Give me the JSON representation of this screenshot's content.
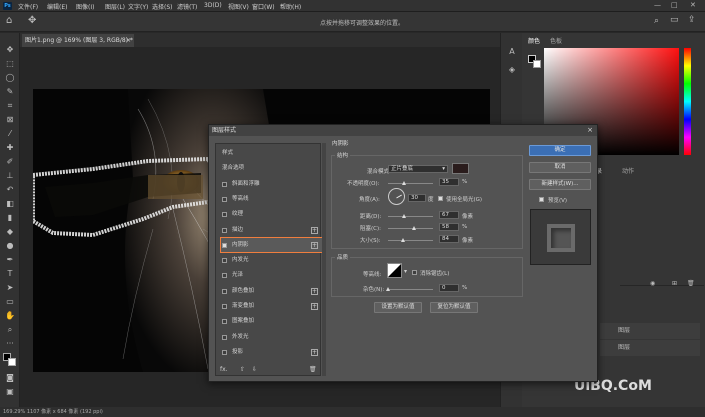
{
  "app": {
    "logo": "Ps"
  },
  "menu": [
    "文件(F)",
    "编辑(E)",
    "图像(I)",
    "图层(L)",
    "文字(Y)",
    "选择(S)",
    "滤镜(T)",
    "3D(D)",
    "视图(V)",
    "窗口(W)",
    "帮助(H)"
  ],
  "window_controls": [
    "—",
    "□",
    "✕"
  ],
  "options_hint": "点按并拖移可调整效果的位置。",
  "document_tab": {
    "label": "图片1.png @ 169% (图层 3, RGB/8) *",
    "close": "×"
  },
  "status_bar": "169.29%   1107 像素 x 684 像素 (192 ppi)",
  "panels": {
    "color_tabs": [
      "颜色",
      "色板"
    ],
    "history_tabs": [
      "历史记录",
      "动作"
    ],
    "layer_items": [
      "图层",
      "图层"
    ],
    "watermark": "UiBQ.CoM"
  },
  "dialog": {
    "title": "图层样式",
    "close": "×",
    "left_list": [
      {
        "label": "样式",
        "check": false,
        "hasbox": false,
        "plus": false
      },
      {
        "label": "混合选项",
        "check": false,
        "hasbox": false,
        "plus": false
      },
      {
        "label": "斜面和浮雕",
        "check": false,
        "hasbox": true,
        "plus": false
      },
      {
        "label": "等高线",
        "check": false,
        "hasbox": true,
        "plus": false
      },
      {
        "label": "纹理",
        "check": false,
        "hasbox": true,
        "plus": false
      },
      {
        "label": "描边",
        "check": false,
        "hasbox": true,
        "plus": true
      },
      {
        "label": "内阴影",
        "check": true,
        "hasbox": true,
        "plus": true
      },
      {
        "label": "内发光",
        "check": false,
        "hasbox": true,
        "plus": false
      },
      {
        "label": "光泽",
        "check": false,
        "hasbox": true,
        "plus": false
      },
      {
        "label": "颜色叠加",
        "check": false,
        "hasbox": true,
        "plus": true
      },
      {
        "label": "渐变叠加",
        "check": false,
        "hasbox": true,
        "plus": true
      },
      {
        "label": "图案叠加",
        "check": false,
        "hasbox": true,
        "plus": false
      },
      {
        "label": "外发光",
        "check": false,
        "hasbox": true,
        "plus": false
      },
      {
        "label": "投影",
        "check": false,
        "hasbox": true,
        "plus": true
      }
    ],
    "list_footer": [
      "fx.",
      "⇧",
      "⇩",
      "🗑"
    ],
    "section_title": "内阴影",
    "structure": {
      "title": "结构",
      "blend_mode_label": "混合模式:",
      "blend_mode_value": "正片叠底",
      "shadow_color": "#2a1c1c",
      "opacity_label": "不透明度(O):",
      "opacity_value": "35",
      "opacity_unit": "%",
      "angle_label": "角度(A):",
      "angle_value": "30",
      "angle_unit": "度",
      "global_light_label": "使用全局光(G)",
      "global_light_checked": true,
      "distance_label": "距离(D):",
      "distance_value": "67",
      "distance_unit": "像素",
      "choke_label": "阻塞(C):",
      "choke_value": "58",
      "choke_unit": "%",
      "size_label": "大小(S):",
      "size_value": "84",
      "size_unit": "像素",
      "levels": {
        "opacity": 0.35,
        "distance": 0.35,
        "choke": 0.58,
        "size": 0.33
      }
    },
    "quality": {
      "title": "品质",
      "contour_label": "等高线:",
      "antialias_label": "消除锯齿(L)",
      "noise_label": "杂色(N):",
      "noise_value": "0",
      "noise_unit": "%"
    },
    "buttons": {
      "set_default": "设置为默认值",
      "reset_default": "复位为默认值",
      "ok": "确定",
      "cancel": "取消",
      "new_style": "新建样式(W)...",
      "preview": "预览(V)",
      "preview_checked": true
    }
  }
}
